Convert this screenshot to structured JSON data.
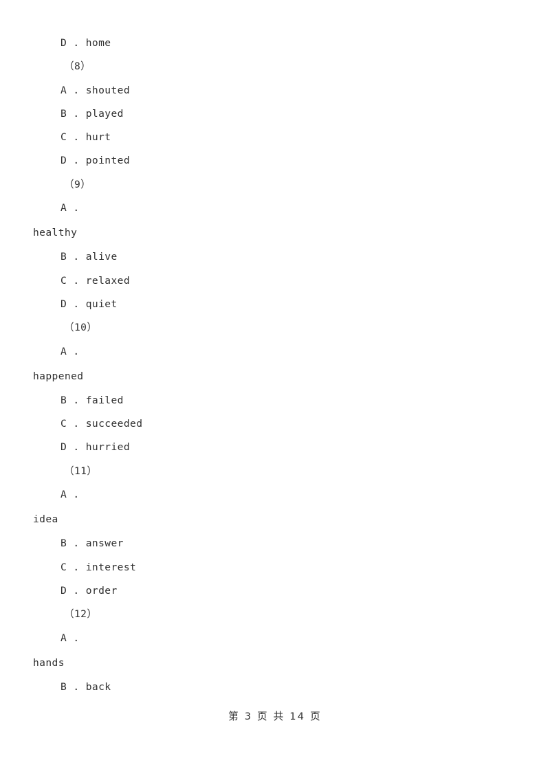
{
  "document": {
    "page_number": 3,
    "total_pages": 14,
    "footer_text": "第 3 页 共 14 页"
  },
  "lines": [
    {
      "kind": "option",
      "text": "D . home"
    },
    {
      "kind": "question",
      "text": "（8）"
    },
    {
      "kind": "option",
      "text": "A . shouted"
    },
    {
      "kind": "option",
      "text": "B . played"
    },
    {
      "kind": "option",
      "text": "C . hurt"
    },
    {
      "kind": "option",
      "text": "D . pointed"
    },
    {
      "kind": "question",
      "text": "（9）"
    },
    {
      "kind": "option-letter",
      "text": "A ."
    },
    {
      "kind": "wrap-word",
      "text": "healthy"
    },
    {
      "kind": "option",
      "text": "B . alive"
    },
    {
      "kind": "option",
      "text": "C . relaxed"
    },
    {
      "kind": "option",
      "text": "D . quiet"
    },
    {
      "kind": "question",
      "text": "（10）"
    },
    {
      "kind": "option-letter",
      "text": "A ."
    },
    {
      "kind": "wrap-word",
      "text": "happened"
    },
    {
      "kind": "option",
      "text": "B . failed"
    },
    {
      "kind": "option",
      "text": "C . succeeded"
    },
    {
      "kind": "option",
      "text": "D . hurried"
    },
    {
      "kind": "question",
      "text": "（11）"
    },
    {
      "kind": "option-letter",
      "text": "A ."
    },
    {
      "kind": "wrap-word",
      "text": "idea"
    },
    {
      "kind": "option",
      "text": "B . answer"
    },
    {
      "kind": "option",
      "text": "C . interest"
    },
    {
      "kind": "option",
      "text": "D . order"
    },
    {
      "kind": "question",
      "text": "（12）"
    },
    {
      "kind": "option-letter",
      "text": "A ."
    },
    {
      "kind": "wrap-word",
      "text": "hands"
    },
    {
      "kind": "option",
      "text": "B . back"
    }
  ],
  "questions": [
    {
      "number": "（8）",
      "options": [
        {
          "letter": "A",
          "text": "shouted"
        },
        {
          "letter": "B",
          "text": "played"
        },
        {
          "letter": "C",
          "text": "hurt"
        },
        {
          "letter": "D",
          "text": "pointed"
        }
      ]
    },
    {
      "number": "（9）",
      "options": [
        {
          "letter": "A",
          "text": "healthy"
        },
        {
          "letter": "B",
          "text": "alive"
        },
        {
          "letter": "C",
          "text": "relaxed"
        },
        {
          "letter": "D",
          "text": "quiet"
        }
      ]
    },
    {
      "number": "（10）",
      "options": [
        {
          "letter": "A",
          "text": "happened"
        },
        {
          "letter": "B",
          "text": "failed"
        },
        {
          "letter": "C",
          "text": "succeeded"
        },
        {
          "letter": "D",
          "text": "hurried"
        }
      ]
    },
    {
      "number": "（11）",
      "options": [
        {
          "letter": "A",
          "text": "idea"
        },
        {
          "letter": "B",
          "text": "answer"
        },
        {
          "letter": "C",
          "text": "interest"
        },
        {
          "letter": "D",
          "text": "order"
        }
      ]
    },
    {
      "number": "（12）",
      "options": [
        {
          "letter": "A",
          "text": "hands"
        },
        {
          "letter": "B",
          "text": "back"
        }
      ]
    }
  ],
  "colors": {
    "page_background": "#ffffff",
    "text": "#2f2f2f"
  }
}
